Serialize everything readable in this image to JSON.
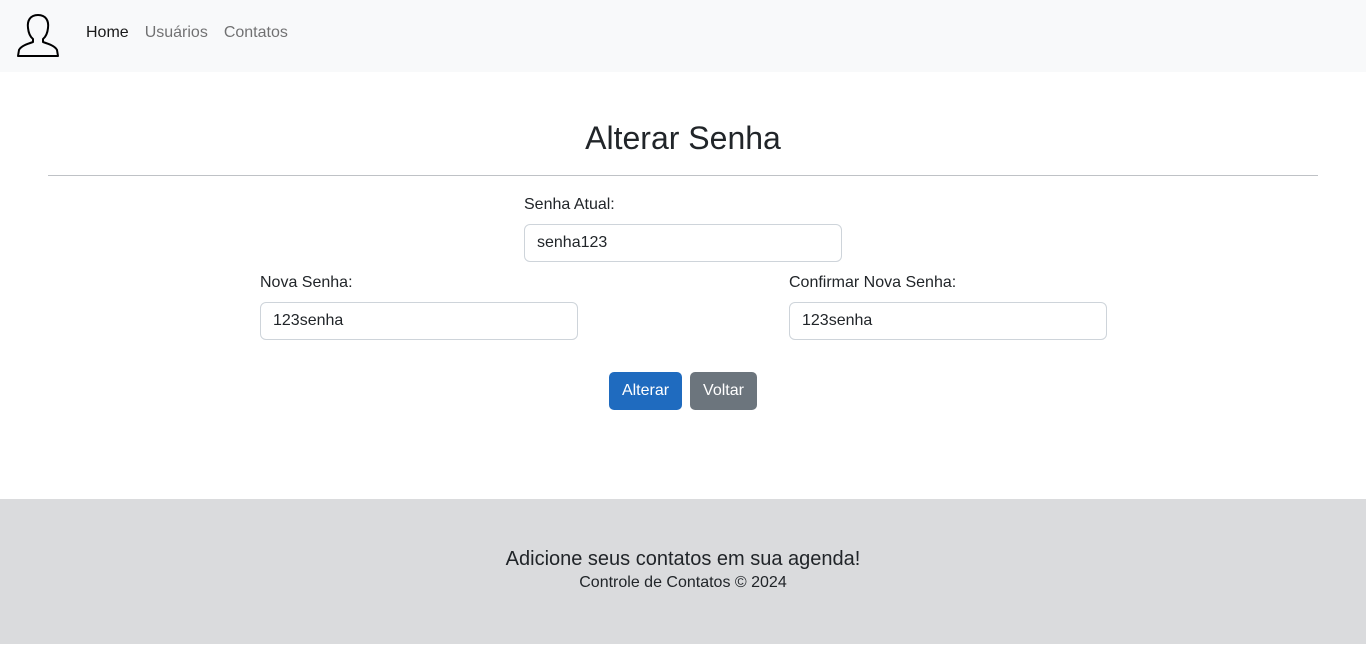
{
  "navbar": {
    "brand_icon": "user-silhouette-icon",
    "links": [
      {
        "label": "Home",
        "active": true
      },
      {
        "label": "Usuários",
        "active": false
      },
      {
        "label": "Contatos",
        "active": false
      }
    ]
  },
  "main": {
    "title": "Alterar Senha",
    "fields": {
      "current_password": {
        "label": "Senha Atual:",
        "value": "senha123"
      },
      "new_password": {
        "label": "Nova Senha:",
        "value": "123senha"
      },
      "confirm_password": {
        "label": "Confirmar Nova Senha:",
        "value": "123senha"
      }
    },
    "buttons": {
      "submit_label": "Alterar",
      "back_label": "Voltar"
    }
  },
  "footer": {
    "heading": "Adicione seus contatos em sua agenda!",
    "copyright": "Controle de Contatos © 2024"
  },
  "colors": {
    "navbar_bg": "#f8f9fa",
    "primary": "#1f6bbf",
    "secondary": "#6c757d",
    "footer_bg": "#dadbdd"
  }
}
